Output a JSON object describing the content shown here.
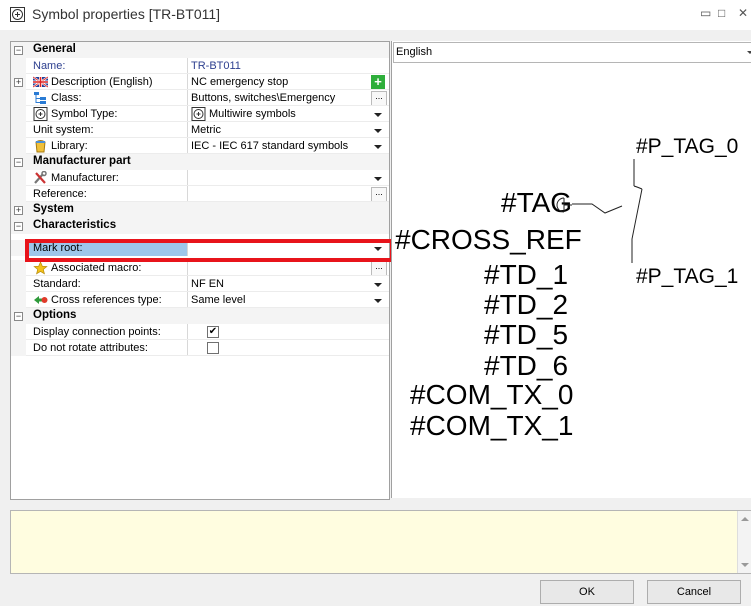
{
  "window": {
    "title": "Symbol properties [TR-BT011]",
    "controls": {
      "minimize": "▭",
      "maximize": "□",
      "close": "✕"
    }
  },
  "grid": {
    "categories": {
      "general": "General",
      "manufacturer_part": "Manufacturer part",
      "system": "System",
      "characteristics": "Characteristics",
      "options": "Options"
    },
    "props": {
      "name": {
        "label": "Name:",
        "value": "TR-BT011"
      },
      "description": {
        "label": "Description (English)",
        "value": "NC emergency stop"
      },
      "class": {
        "label": "Class:",
        "value": "Buttons, switches\\Emergency"
      },
      "symbol_type": {
        "label": "Symbol Type:",
        "value": "Multiwire symbols"
      },
      "unit_system": {
        "label": "Unit system:",
        "value": "Metric"
      },
      "library": {
        "label": "Library:",
        "value": "IEC - IEC 617 standard symbols"
      },
      "manufacturer": {
        "label": "Manufacturer:",
        "value": ""
      },
      "reference": {
        "label": "Reference:",
        "value": ""
      },
      "mark_root": {
        "label": "Mark root:",
        "value": ""
      },
      "associated_macro": {
        "label": "Associated macro:",
        "value": ""
      },
      "standard": {
        "label": "Standard:",
        "value": "NF EN"
      },
      "cross_ref_type": {
        "label": "Cross references type:",
        "value": "Same level"
      },
      "display_conn_points": {
        "label": "Display connection points:",
        "checked": "✔"
      },
      "dont_rotate": {
        "label": "Do not rotate attributes:",
        "checked": ""
      }
    },
    "expanders": {
      "minus": "−",
      "plus": "+"
    },
    "ellipsis": "...",
    "plus_button": "+"
  },
  "preview": {
    "language": "English",
    "texts": {
      "tag": "#TAG",
      "cross_ref": "#CROSS_REF",
      "td1": "#TD_1",
      "td2": "#TD_2",
      "td5": "#TD_5",
      "td6": "#TD_6",
      "com_tx0": "#COM_TX_0",
      "com_tx1": "#COM_TX_1",
      "p_tag0": "#P_TAG_0",
      "p_tag1": "#P_TAG_1"
    }
  },
  "buttons": {
    "ok": "OK",
    "cancel": "Cancel"
  },
  "colors": {
    "highlight": "#e8141b",
    "selected": "#9ec6ea",
    "notes_bg": "#fffde0",
    "add_green": "#2eae3a"
  }
}
